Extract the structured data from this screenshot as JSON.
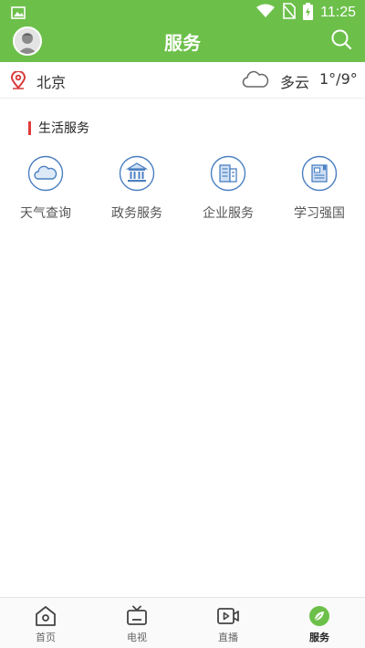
{
  "status_bar": {
    "time": "11:25"
  },
  "header": {
    "title": "服务"
  },
  "weather": {
    "city": "北京",
    "condition": "多云",
    "temperature": "1°/9°"
  },
  "section": {
    "title": "生活服务"
  },
  "services": [
    {
      "label": "天气查询",
      "icon": "weather-cloud-icon"
    },
    {
      "label": "政务服务",
      "icon": "government-building-icon"
    },
    {
      "label": "企业服务",
      "icon": "enterprise-buildings-icon"
    },
    {
      "label": "学习强国",
      "icon": "learning-book-icon"
    }
  ],
  "bottom_nav": [
    {
      "label": "首页",
      "icon": "home-icon",
      "active": false
    },
    {
      "label": "电视",
      "icon": "tv-icon",
      "active": false
    },
    {
      "label": "直播",
      "icon": "live-video-icon",
      "active": false
    },
    {
      "label": "服务",
      "icon": "compass-leaf-icon",
      "active": true
    }
  ],
  "colors": {
    "brand_green": "#6cc04a",
    "accent_blue": "#4a7fc1",
    "marker_red": "#e23b3b"
  }
}
